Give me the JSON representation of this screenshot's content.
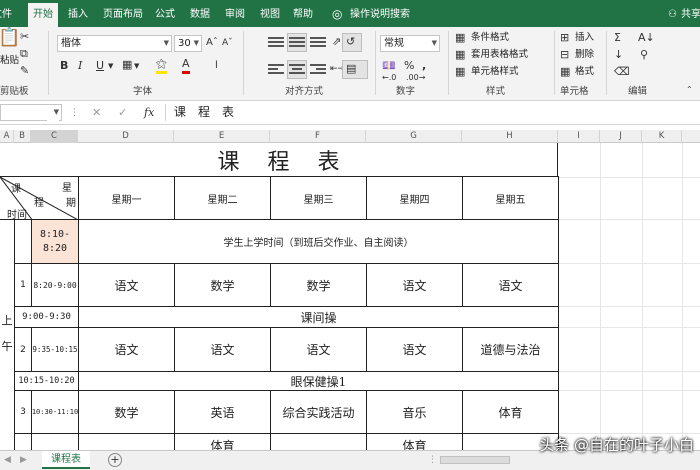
{
  "ribbon_tabs": [
    "文件",
    "开始",
    "插入",
    "页面布局",
    "公式",
    "数据",
    "审阅",
    "视图",
    "帮助",
    "操作说明搜索",
    "共享"
  ],
  "clipboard": {
    "paste_label": "粘贴",
    "group_label": "剪贴板"
  },
  "font": {
    "name": "楷体",
    "size": "30",
    "group_label": "字体"
  },
  "alignment": {
    "group_label": "对齐方式"
  },
  "number": {
    "format": "常规",
    "group_label": "数字"
  },
  "styles": {
    "conditional": "条件格式",
    "table": "套用表格格式",
    "cell": "单元格样式",
    "group_label": "样式"
  },
  "cells": {
    "insert": "插入",
    "delete": "删除",
    "format": "格式",
    "group_label": "单元格"
  },
  "editing": {
    "group_label": "编辑"
  },
  "formula_bar": {
    "fx": "fx",
    "content": "课程表"
  },
  "columns": [
    "A",
    "B",
    "C",
    "D",
    "E",
    "F",
    "G",
    "H",
    "I",
    "J",
    "K"
  ],
  "sheet": {
    "title": "课    程    表",
    "corner": {
      "top": "星",
      "top2": "期",
      "mid": "程",
      "left": "课",
      "bottom": "时间"
    },
    "weekdays": [
      "星期一",
      "星期二",
      "星期三",
      "星期四",
      "星期五"
    ],
    "morning_label": "上午",
    "row_arrival": {
      "time": "8:10-8:20",
      "text": "学生上学时间（到班后交作业、自主阅读）"
    },
    "row1": {
      "num": "1",
      "time": "8:20-9:00",
      "subjects": [
        "语文",
        "数学",
        "数学",
        "语文",
        "语文"
      ]
    },
    "row_break": {
      "time": "9:00-9:30",
      "text": "课间操"
    },
    "row2": {
      "num": "2",
      "time": "9:35-10:15",
      "subjects": [
        "语文",
        "语文",
        "语文",
        "语文",
        "道德与法治"
      ]
    },
    "row_eye": {
      "time": "10:15-10:20",
      "text": "眼保健操1"
    },
    "row3": {
      "num": "3",
      "time": "10:30-11:10",
      "subjects": [
        "数学",
        "英语",
        "综合实践活动",
        "音乐",
        "体育"
      ]
    },
    "row4_partial": [
      "体育",
      "体育"
    ]
  },
  "sheet_tab": "课程表",
  "watermark": "头条 @自在的叶子小白"
}
